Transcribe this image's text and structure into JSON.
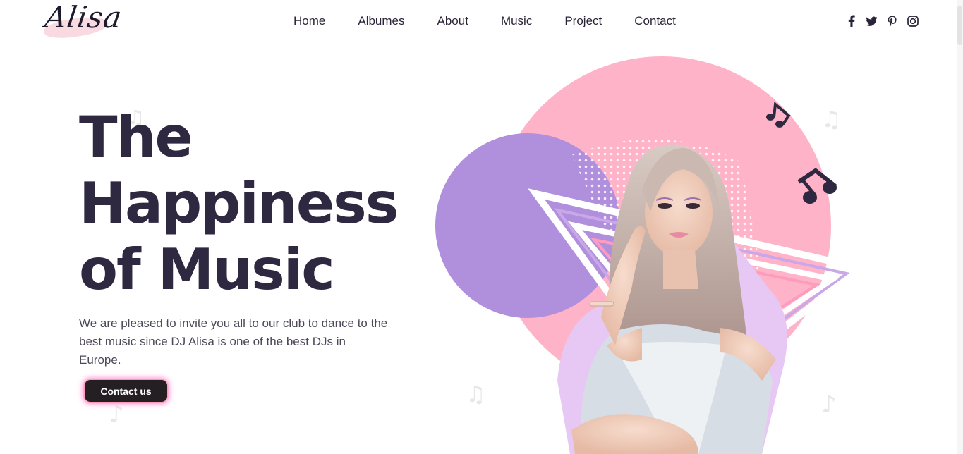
{
  "brand": {
    "logo_text": "Alisa"
  },
  "nav": {
    "items": [
      {
        "label": "Home"
      },
      {
        "label": "Albumes"
      },
      {
        "label": "About"
      },
      {
        "label": "Music"
      },
      {
        "label": "Project"
      },
      {
        "label": "Contact"
      }
    ]
  },
  "social": {
    "icons": [
      "facebook-icon",
      "twitter-icon",
      "pinterest-icon",
      "instagram-icon"
    ]
  },
  "hero": {
    "title_lines": [
      "The",
      "Happiness",
      "of Music"
    ],
    "description": "We are pleased to invite you all to our club to dance to the best music since DJ Alisa is one of the best DJs in Europe.",
    "cta_label": "Contact us"
  },
  "colors": {
    "title": "#2e2840",
    "pink_circle": "#ffb3c8",
    "purple_circle": "#b08fdc",
    "button": "#231f22",
    "button_glow": "#ff6ec8"
  }
}
